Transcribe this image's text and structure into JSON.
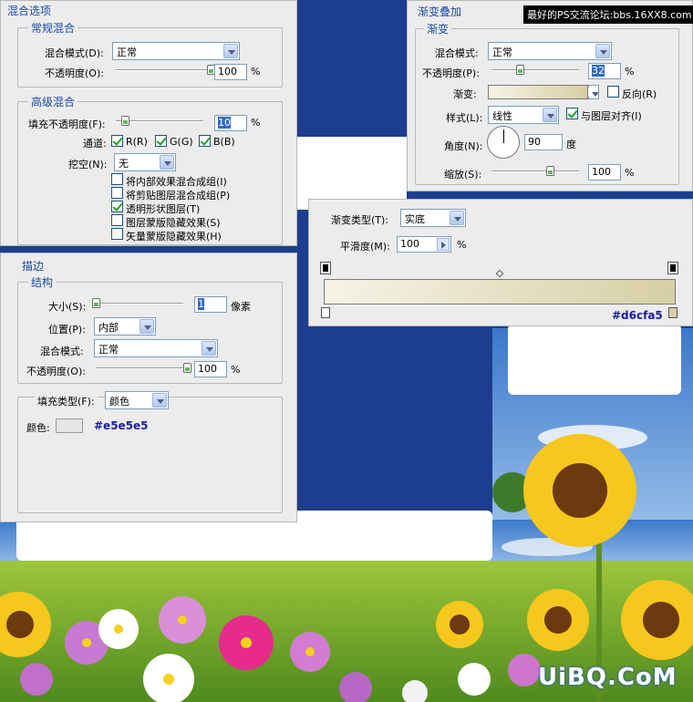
{
  "blending_options": {
    "title": "混合选项",
    "general": {
      "title": "常规混合",
      "blend_mode_label": "混合模式(D):",
      "blend_mode_value": "正常",
      "opacity_label": "不透明度(O):",
      "opacity_value": "100",
      "opacity_unit": "%",
      "opacity_level": 1.0
    },
    "advanced": {
      "title": "高级混合",
      "fill_opacity_label": "填充不透明度(F):",
      "fill_opacity_value": "10",
      "fill_opacity_unit": "%",
      "fill_opacity_level": 0.1,
      "channels_label": "通道:",
      "channels": [
        {
          "label": "R(R)",
          "checked": true
        },
        {
          "label": "G(G)",
          "checked": true
        },
        {
          "label": "B(B)",
          "checked": true
        }
      ],
      "knockout_label": "挖空(N):",
      "knockout_value": "无",
      "options": [
        {
          "label": "将内部效果混合成组(I)",
          "checked": false
        },
        {
          "label": "将剪贴图层混合成组(P)",
          "checked": false
        },
        {
          "label": "透明形状图层(T)",
          "checked": true
        },
        {
          "label": "图层蒙版隐藏效果(S)",
          "checked": false
        },
        {
          "label": "矢量蒙版隐藏效果(H)",
          "checked": false
        }
      ]
    }
  },
  "stroke": {
    "title": "描边",
    "structure": {
      "title": "结构",
      "size_label": "大小(S):",
      "size_value": "1",
      "size_unit": "像素",
      "position_label": "位置(P):",
      "position_value": "内部",
      "blend_mode_label": "混合模式:",
      "blend_mode_value": "正常",
      "opacity_label": "不透明度(O):",
      "opacity_value": "100",
      "opacity_unit": "%",
      "size_level": 0.0,
      "opacity_level": 1.0
    },
    "fill_type_label": "填充类型(F):",
    "fill_type_value": "颜色",
    "color_label": "颜色:",
    "color_hex": "#e5e5e5"
  },
  "gradient_overlay": {
    "title": "渐变叠加",
    "group_title": "渐变",
    "blend_mode_label": "混合模式:",
    "blend_mode_value": "正常",
    "opacity_label": "不透明度(P):",
    "opacity_value": "32",
    "opacity_unit": "%",
    "opacity_level": 0.32,
    "gradient_label": "渐变:",
    "reverse_label": "反向(R)",
    "reverse_checked": false,
    "style_label": "样式(L):",
    "style_value": "线性",
    "align_label": "与图层对齐(I)",
    "align_checked": true,
    "angle_label": "角度(N):",
    "angle_value": "90",
    "angle_unit": "度",
    "scale_label": "缩放(S):",
    "scale_value": "100",
    "scale_unit": "%",
    "scale_level": 0.67
  },
  "gradient_editor": {
    "type_label": "渐变类型(T):",
    "type_value": "实底",
    "smoothness_label": "平滑度(M):",
    "smoothness_value": "100",
    "smoothness_unit": "%",
    "end_color_hex": "#d6cfa5",
    "start_color": "#f6f3e6"
  },
  "watermark_top": "最好的PS交流论坛:bbs.16XX8.com",
  "watermark_logo": "UiBQ.CoM",
  "colors": {
    "accent_blue": "#1a49a6",
    "panel_bg": "#ececec",
    "background_blue": "#1d3e8e"
  }
}
